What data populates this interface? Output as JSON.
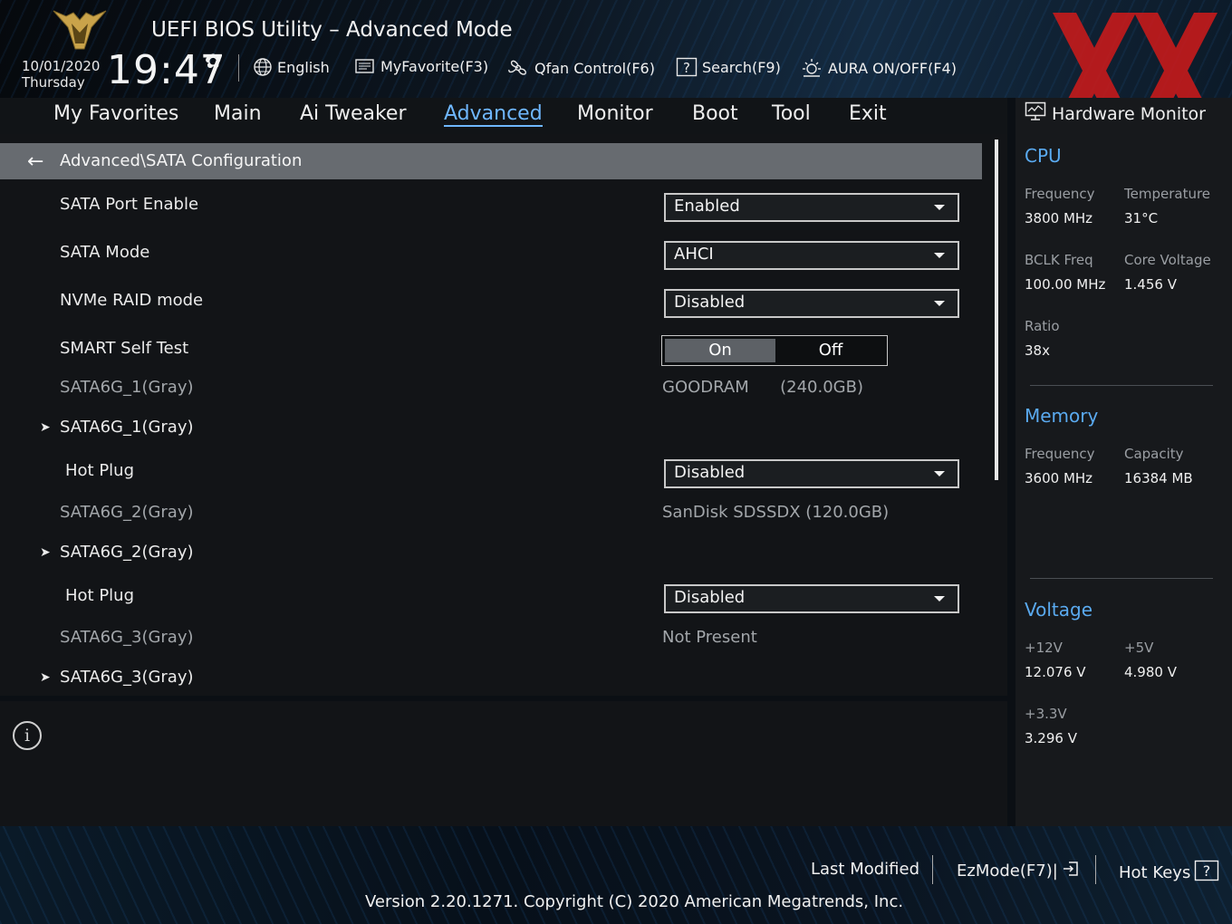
{
  "header": {
    "title": "UEFI BIOS Utility – Advanced Mode",
    "date": "10/01/2020",
    "weekday": "Thursday",
    "time": "19:47",
    "toolbar": {
      "language": "English",
      "favorite": "MyFavorite(F3)",
      "qfan": "Qfan Control(F6)",
      "search": "Search(F9)",
      "aura": "AURA ON/OFF(F4)"
    }
  },
  "tabs": [
    "My Favorites",
    "Main",
    "Ai Tweaker",
    "Advanced",
    "Monitor",
    "Boot",
    "Tool",
    "Exit"
  ],
  "active_tab": "Advanced",
  "breadcrumb": "Advanced\\SATA Configuration",
  "settings": {
    "sata_port_enable": {
      "label": "SATA Port Enable",
      "value": "Enabled"
    },
    "sata_mode": {
      "label": "SATA Mode",
      "value": "AHCI"
    },
    "nvme_raid": {
      "label": "NVMe RAID mode",
      "value": "Disabled"
    },
    "smart_self_test": {
      "label": "SMART Self Test",
      "on_label": "On",
      "off_label": "Off",
      "selected": "On"
    },
    "port1_info": {
      "label": "SATA6G_1(Gray)",
      "value": "GOODRAM      (240.0GB)"
    },
    "port1_submenu": "SATA6G_1(Gray)",
    "port1_hotplug": {
      "label": "Hot Plug",
      "value": "Disabled"
    },
    "port2_info": {
      "label": "SATA6G_2(Gray)",
      "value": "SanDisk SDSSDX (120.0GB)"
    },
    "port2_submenu": "SATA6G_2(Gray)",
    "port2_hotplug": {
      "label": "Hot Plug",
      "value": "Disabled"
    },
    "port3_info": {
      "label": "SATA6G_3(Gray)",
      "value": "Not Present"
    },
    "port3_submenu": "SATA6G_3(Gray)"
  },
  "hardware_monitor": {
    "title": "Hardware Monitor",
    "cpu": {
      "heading": "CPU",
      "frequency_label": "Frequency",
      "frequency": "3800 MHz",
      "temperature_label": "Temperature",
      "temperature": "31°C",
      "bclk_label": "BCLK Freq",
      "bclk": "100.00 MHz",
      "core_voltage_label": "Core Voltage",
      "core_voltage": "1.456 V",
      "ratio_label": "Ratio",
      "ratio": "38x"
    },
    "memory": {
      "heading": "Memory",
      "frequency_label": "Frequency",
      "frequency": "3600 MHz",
      "capacity_label": "Capacity",
      "capacity": "16384 MB"
    },
    "voltage": {
      "heading": "Voltage",
      "v12_label": "+12V",
      "v12": "12.076 V",
      "v5_label": "+5V",
      "v5": "4.980 V",
      "v33_label": "+3.3V",
      "v33": "3.296 V"
    }
  },
  "footer": {
    "last_modified": "Last Modified",
    "ezmode": "EzMode(F7)|",
    "hotkeys": "Hot Keys",
    "version": "Version 2.20.1271. Copyright (C) 2020 American Megatrends, Inc."
  },
  "colors": {
    "accent": "#6fb7ff",
    "section_heading": "#5aaaf0",
    "watermark": "#d01a1a"
  },
  "icons": [
    "tuf-logo-icon",
    "gear-icon",
    "globe-icon",
    "favorite-icon",
    "fan-icon",
    "search-help-icon",
    "aura-icon",
    "back-arrow-icon",
    "chevron-right-icon",
    "caret-down-icon",
    "info-icon",
    "monitor-icon",
    "exit-icon",
    "help-icon"
  ]
}
